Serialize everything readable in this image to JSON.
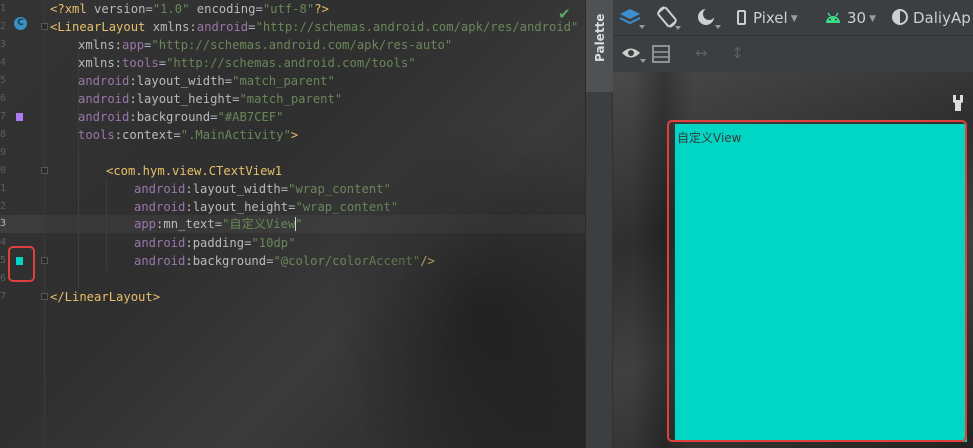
{
  "editor": {
    "line_numbers": [
      "1",
      "2",
      "3",
      "4",
      "5",
      "6",
      "7",
      "8",
      "9",
      "0",
      "1",
      "2",
      "3",
      "4",
      "5",
      "6",
      "7"
    ],
    "current_line_number": "3",
    "code": {
      "l1_pi_open": "<?",
      "l1_pi_name": "xml",
      "l1_attr1": " version",
      "l1_eq1": "=",
      "l1_val1": "\"1.0\"",
      "l1_attr2": " encoding",
      "l1_eq2": "=",
      "l1_val2": "\"utf-8\"",
      "l1_pi_close": "?>",
      "l2_tag": "<LinearLayout",
      "l2_attr": " xmlns:",
      "l2_ns": "android",
      "l2_eq": "=",
      "l2_val": "\"http://schemas.android.com/apk/res/android\"",
      "l3_attr": "xmlns:",
      "l3_ns": "app",
      "l3_eq": "=",
      "l3_val": "\"http://schemas.android.com/apk/res-auto\"",
      "l4_attr": "xmlns:",
      "l4_ns": "tools",
      "l4_eq": "=",
      "l4_val": "\"http://schemas.android.com/tools\"",
      "l5_ns": "android",
      "l5_attr": ":layout_width",
      "l5_eq": "=",
      "l5_val": "\"match_parent\"",
      "l6_ns": "android",
      "l6_attr": ":layout_height",
      "l6_eq": "=",
      "l6_val": "\"match_parent\"",
      "l7_ns": "android",
      "l7_attr": ":background",
      "l7_eq": "=",
      "l7_val": "\"#AB7CEF\"",
      "l8_ns": "tools",
      "l8_attr": ":context",
      "l8_eq": "=",
      "l8_val": "\".MainActivity\"",
      "l8_close": ">",
      "l10_tag": "<com.hym.view.CTextView1",
      "l11_ns": "android",
      "l11_attr": ":layout_width",
      "l11_eq": "=",
      "l11_val": "\"wrap_content\"",
      "l12_ns": "android",
      "l12_attr": ":layout_height",
      "l12_eq": "=",
      "l12_val": "\"wrap_content\"",
      "l13_ns": "app",
      "l13_attr": ":mn_text",
      "l13_eq": "=",
      "l13_val": "\"自定义View\"",
      "l14_ns": "android",
      "l14_attr": ":padding",
      "l14_eq": "=",
      "l14_val": "\"10dp\"",
      "l15_ns": "android",
      "l15_attr": ":background",
      "l15_eq": "=",
      "l15_val": "\"@color/colorAccent\"",
      "l15_close": "/>",
      "l17_tag": "</LinearLayout>"
    },
    "gutter_class_icon": "C",
    "swatch_colors": {
      "background": "#AB7CEF",
      "accent": "#00D6C3"
    },
    "checkmark": "✔"
  },
  "palette": {
    "label": "Palette"
  },
  "design_toolbar": {
    "device": "Pixel",
    "api_level": "30",
    "theme": "DaliyAp",
    "icons": [
      "layers-icon",
      "orientation-icon",
      "night-mode-icon",
      "phone-icon",
      "android-icon",
      "theme-icon",
      "eye-icon",
      "blueprint-icon",
      "horizontal-resize-icon",
      "vertical-resize-icon",
      "wrench-icon"
    ]
  },
  "preview": {
    "ctextview_text": "自定义View",
    "accent_color": "#00D6C3",
    "highlight_color": "#E0403D"
  }
}
